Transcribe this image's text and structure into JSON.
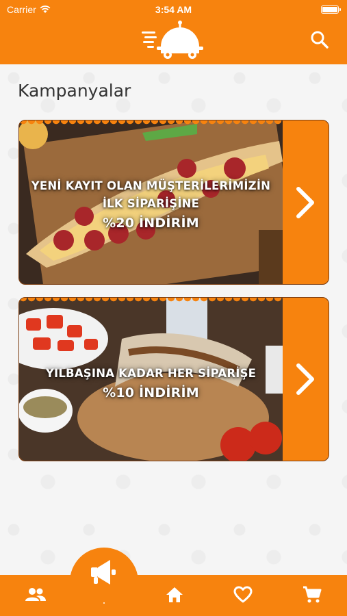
{
  "status_bar": {
    "carrier": "Carrier",
    "time": "3:54 AM"
  },
  "page": {
    "title": "Kampanyalar"
  },
  "campaigns": [
    {
      "lines": [
        "YENİ KAYIT OLAN MÜŞTERİLERİMİZİN",
        "İLK SİPARİŞİNE",
        "%20 İNDİRİM"
      ]
    },
    {
      "lines": [
        "YILBAŞINA KADAR HER SİPARİŞE",
        "%10 İNDİRİM"
      ]
    }
  ],
  "nav": {
    "items": [
      "users-icon",
      "megaphone-icon",
      "home-icon",
      "heart-icon",
      "cart-icon"
    ],
    "active": "megaphone-icon"
  },
  "colors": {
    "brand_orange": "#f7830e",
    "card_border": "#7a3c10",
    "text_dark": "#333333"
  }
}
